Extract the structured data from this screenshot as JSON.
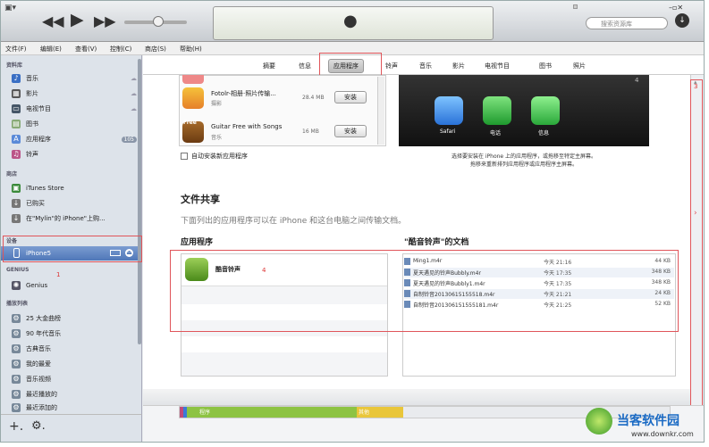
{
  "toolbar": {
    "search_placeholder": "搜索资源库"
  },
  "menu": [
    "文件(F)",
    "编辑(E)",
    "查看(V)",
    "控制(C)",
    "商店(S)",
    "帮助(H)"
  ],
  "sidebar": {
    "library_header": "资料库",
    "library": [
      "音乐",
      "影片",
      "电视节目",
      "图书",
      "应用程序",
      "铃声"
    ],
    "apps_badge": "105",
    "store_header": "商店",
    "store": [
      "iTunes Store",
      "已购买",
      "在\"Mylin\"的 iPhone\"上购..."
    ],
    "devices_header": "设备",
    "device": "iPhone5",
    "genius_header": "GENIUS",
    "genius": "Genius",
    "playlists_header": "播放列表",
    "playlists": [
      "25 大金曲榜",
      "90 年代音乐",
      "古典音乐",
      "我的最爱",
      "音乐视频",
      "最近播放的",
      "最近添加的"
    ]
  },
  "tabs": [
    "摘要",
    "信息",
    "应用程序",
    "铃声",
    "音乐",
    "影片",
    "电视节目",
    "图书",
    "照片"
  ],
  "apps": [
    {
      "name": "Fotolr-相册·照片传输...",
      "sub": "摄影",
      "size": "28.4 MB",
      "btn": "安装"
    },
    {
      "name": "Guitar Free with Songs",
      "sub": "音乐",
      "size": "16 MB",
      "btn": "安装"
    }
  ],
  "free_label": "Free",
  "auto_sync": "自动安装新应用程序",
  "phone_apps": [
    "Safari",
    "电话",
    "信息"
  ],
  "phone_caption1": "选择要安装在 iPhone 上的应用程序，或拖移至特定主屏幕。",
  "phone_caption2": "拖移来重新排列应用程序或应用程序主屏幕。",
  "file_sharing": {
    "title": "文件共享",
    "desc": "下面列出的应用程序可以在 iPhone 和这台电脑之间传输文档。",
    "apps_header": "应用程序",
    "docs_header": "\"酷音铃声\"的文档",
    "app": "酷音铃声",
    "docs": [
      {
        "name": "Ming1.m4r",
        "time": "今天 21:16",
        "size": "44 KB"
      },
      {
        "name": "夏天遇见的铃声Bubbly.m4r",
        "time": "今天 17:35",
        "size": "348 KB"
      },
      {
        "name": "夏天遇见的铃声Bubbly1.m4r",
        "time": "今天 17:35",
        "size": "348 KB"
      },
      {
        "name": "自制铃音20130615155518.m4r",
        "time": "今天 21:21",
        "size": "24 KB"
      },
      {
        "name": "自制铃音201306151555181.m4r",
        "time": "今天 21:25",
        "size": "52 KB"
      }
    ]
  },
  "capacity": {
    "apps": "程序",
    "other": "其他"
  },
  "annotations": [
    "1",
    "2",
    "3",
    "4",
    "4"
  ],
  "watermark": {
    "title": "当客软件园",
    "url": "www.downkr.com"
  }
}
